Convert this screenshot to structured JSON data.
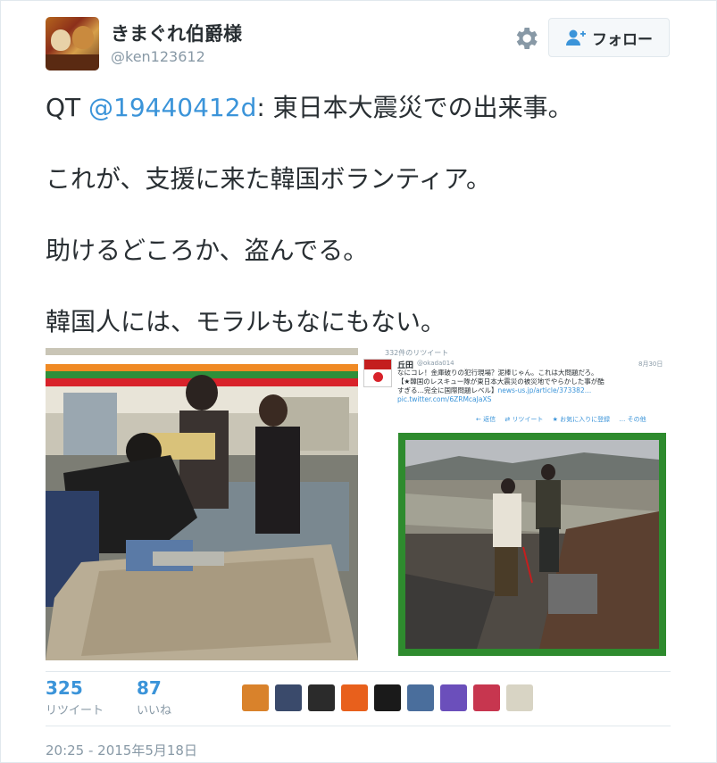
{
  "user": {
    "display_name": "きまぐれ伯爵様",
    "screen_name": "@ken123612"
  },
  "follow_button": {
    "label": "フォロー"
  },
  "tweet": {
    "qt_prefix": "QT ",
    "mention": "@19440412d",
    "line1_rest": ": 東日本大震災での出来事。",
    "line2": "これが、支援に来た韓国ボランティア。",
    "line3": "助けるどころか、盗んでる。",
    "line4": "韓国人には、モラルもなにもない。"
  },
  "embedded_tweet": {
    "retweet_count_text": "332件のリツイート",
    "author": "丘田",
    "handle": "@okada014",
    "date": "8月30日",
    "text1": "なにコレ！金庫破りの犯行現場？泥棒じゃん。これは大問題だろ。",
    "text2": "【★韓国のレスキュー隊が東日本大震災の被災地でやらかした事が酷",
    "text3": "すぎる…完全に国際問題レベル】",
    "link": "news-us.jp/article/373382…",
    "pic_link": "pic.twitter.com/6ZRMcaJaXS",
    "actions": [
      "返信",
      "リツイート",
      "お気に入りに登録",
      "その他"
    ]
  },
  "stats": {
    "retweets": {
      "count": "325",
      "label": "リツイート"
    },
    "likes": {
      "count": "87",
      "label": "いいね"
    }
  },
  "likers": [
    {
      "name": "liker-avatar-1",
      "color": "#d9822b"
    },
    {
      "name": "liker-avatar-2",
      "color": "#3a4a6b"
    },
    {
      "name": "liker-avatar-3",
      "color": "#2b2b2b"
    },
    {
      "name": "liker-avatar-4",
      "color": "#e8601c"
    },
    {
      "name": "liker-avatar-5",
      "color": "#1a1a1a"
    },
    {
      "name": "liker-avatar-6",
      "color": "#4a6e9c"
    },
    {
      "name": "liker-avatar-7",
      "color": "#6b4fbb"
    },
    {
      "name": "liker-avatar-8",
      "color": "#c7364f"
    },
    {
      "name": "liker-avatar-9",
      "color": "#d8d4c4"
    }
  ],
  "timestamp": "20:25 - 2015年5月18日",
  "colors": {
    "link": "#3b94d9",
    "muted": "#8899a6",
    "text": "#292f33",
    "border": "#e1e8ed",
    "green_frame": "#2e8b2e"
  }
}
